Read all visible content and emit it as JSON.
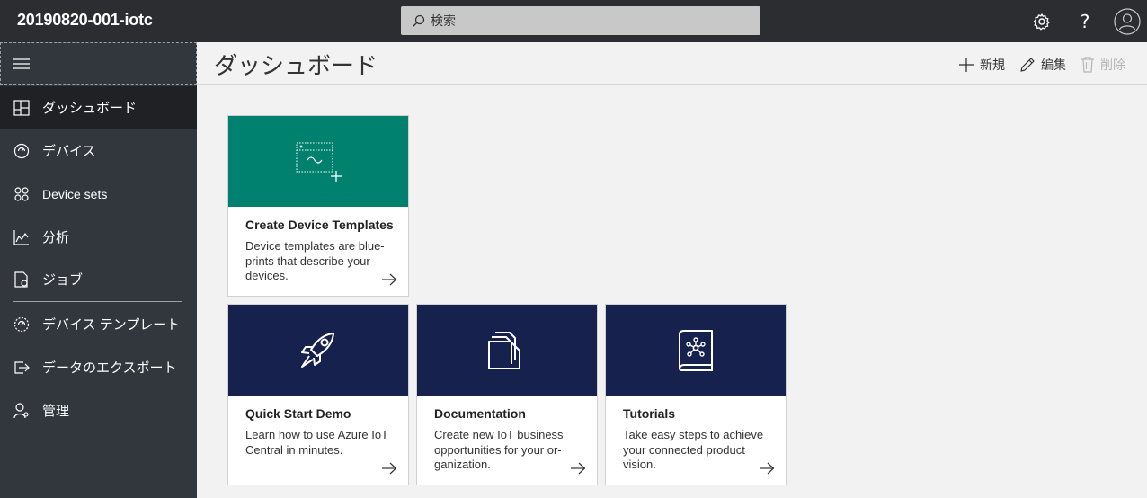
{
  "app": {
    "title": "20190820-001-iotc"
  },
  "search": {
    "placeholder": "検索"
  },
  "topbar_icons": [
    "gear-icon",
    "help-icon",
    "account-icon"
  ],
  "help_glyph": "?",
  "sidebar": {
    "items": [
      {
        "label": "ダッシュボード",
        "icon": "dashboard-icon",
        "active": true
      },
      {
        "label": "デバイス",
        "icon": "devices-icon"
      },
      {
        "label": "Device sets",
        "icon": "device-sets-icon"
      },
      {
        "label": "分析",
        "icon": "analytics-icon"
      },
      {
        "label": "ジョブ",
        "icon": "jobs-icon"
      },
      {
        "label": "デバイス テンプレート",
        "icon": "device-templates-icon"
      },
      {
        "label": "データのエクスポート",
        "icon": "data-export-icon"
      },
      {
        "label": "管理",
        "icon": "administration-icon"
      }
    ]
  },
  "page": {
    "title": "ダッシュボード"
  },
  "commands": {
    "new_label": "新規",
    "edit_label": "編集",
    "delete_label": "削除"
  },
  "colors": {
    "topbar": "#2b2d30",
    "sidebar": "#32373d",
    "green": "#00816f",
    "navy": "#17214e"
  },
  "cards": [
    {
      "title": "Create Device Templates",
      "description": "Device templates are blue-prints that describe your devices.",
      "icon": "device-template-icon",
      "banner": "green"
    },
    {
      "title": "Quick Start Demo",
      "description": "Learn how to use Azure IoT Central in minutes.",
      "icon": "rocket-icon",
      "banner": "navy"
    },
    {
      "title": "Documentation",
      "description": "Create new IoT business opportunities for your or-ganization.",
      "icon": "folder-icon",
      "banner": "navy"
    },
    {
      "title": "Tutorials",
      "description": "Take easy steps to achieve your connected product vision.",
      "icon": "book-icon",
      "banner": "navy"
    }
  ]
}
